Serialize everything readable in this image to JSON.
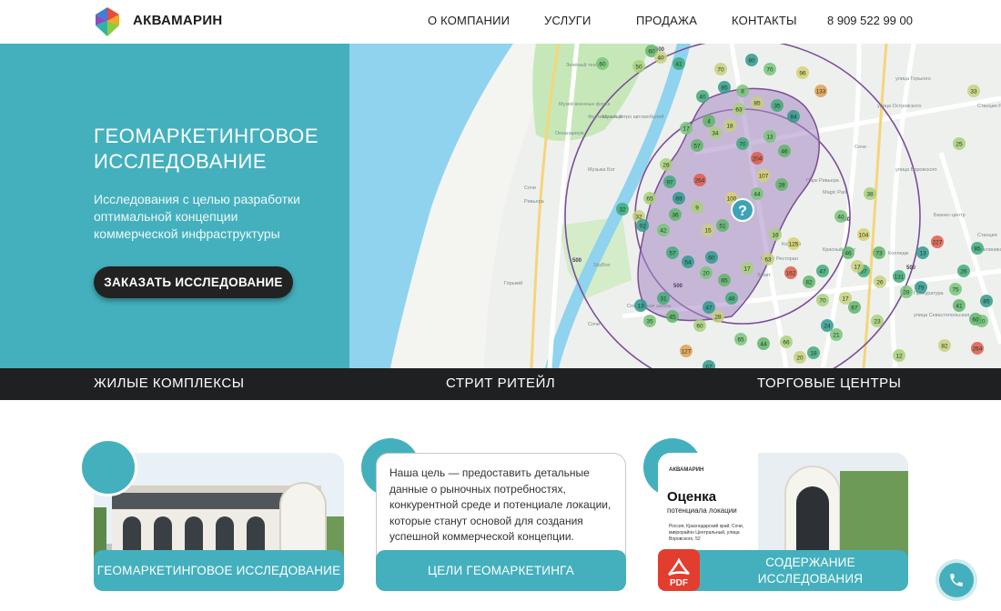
{
  "header": {
    "brand": "АКВАМАРИН",
    "nav": [
      {
        "label": "О КОМПАНИИ"
      },
      {
        "label": "УСЛУГИ"
      },
      {
        "label": "ПРОДАЖА"
      },
      {
        "label": "КОНТАКТЫ"
      }
    ],
    "phone": "8 909 522 99 00"
  },
  "hero": {
    "title": "ГЕОМАРКЕТИНГОВОЕ ИССЛЕДОВАНИЕ",
    "subtitle": "Исследования с целью разработки оптимальной концепции коммерческой инфраструктуры",
    "cta_label": "ЗАКАЗАТЬ ИССЛЕДОВАНИЕ"
  },
  "map": {
    "marker_values": [
      "60",
      "60",
      "50",
      "40",
      "41",
      "80",
      "70",
      "96",
      "133",
      "70",
      "40",
      "85",
      "8",
      "4",
      "63",
      "85",
      "35",
      "84",
      "17",
      "57",
      "34",
      "18",
      "70",
      "204",
      "13",
      "46",
      "26",
      "264",
      "97",
      "69",
      "107",
      "28",
      "65",
      "32",
      "32",
      "92",
      "42",
      "36",
      "9",
      "15",
      "100",
      "60",
      "44",
      "51",
      "16",
      "125",
      "57",
      "54",
      "20",
      "65",
      "17",
      "63",
      "48",
      "47",
      "162",
      "82",
      "70",
      "17",
      "37",
      "104",
      "40",
      "46",
      "38",
      "17",
      "31",
      "13",
      "35",
      "45",
      "60",
      "28",
      "127",
      "67",
      "65",
      "44",
      "66",
      "20",
      "18",
      "24",
      "21",
      "67",
      "23",
      "26",
      "131",
      "79",
      "75",
      "41",
      "25",
      "33",
      "85",
      "85",
      "10",
      "60",
      "264",
      "227",
      "26",
      "13",
      "28",
      "73",
      "12",
      "82",
      "47"
    ],
    "question_mark": "?",
    "labels": [
      "Зелёный театр",
      "Музей военных флага",
      "Фестивальный",
      "Океанариум",
      "Музыка Бот",
      "Музей ретро автомобилей",
      "Сочи",
      "Ривьера",
      "SkyBox",
      "Горький",
      "Сочи",
      "Спортивная школа",
      "Спорт Ресторан",
      "Парк Ривьера",
      "Magic Park",
      "Колизей",
      "Зенит",
      "Красный флаг",
      "Колледж",
      "улица Горького",
      "улица Островского",
      "Сочи",
      "Станция Ривьера",
      "улица Воровского",
      "Бизнес-центр",
      "Станция",
      "Поликлиника",
      "Прокуратура",
      "улица Севастопольская"
    ],
    "road_labels": [
      "500",
      "500",
      "500",
      "500",
      "500"
    ]
  },
  "strip": {
    "items": [
      "ЖИЛЫЕ КОМПЛЕКСЫ",
      "СТРИТ РИТЕЙЛ",
      "ТОРГОВЫЕ ЦЕНТРЫ"
    ]
  },
  "cards": [
    {
      "label": "ГЕОМАРКЕТИНГОВОЕ ИССЛЕДОВАНИЕ"
    },
    {
      "text": "Наша цель — предоставить детальные данные о рыночных потребностях, конкурентной среде и потенциале локации, которые станут основой для создания успешной коммерческой концепции.",
      "label": "ЦЕЛИ ГЕОМАРКЕТИНГА"
    },
    {
      "label": "СОДЕРЖАНИЕ ИССЛЕДОВАНИЯ",
      "doc_brand": "АКВАМАРИН",
      "doc_title": "Оценка",
      "doc_subtitle": "потенциала локации",
      "doc_address": "Россия, Краснодарский край, Сочи, микрорайон Центральный, улица Воровского, 52",
      "pdf_label": "PDF"
    }
  ],
  "colors": {
    "accent": "#44b0bd",
    "dark": "#1f2021",
    "zone": "#a889c4"
  }
}
